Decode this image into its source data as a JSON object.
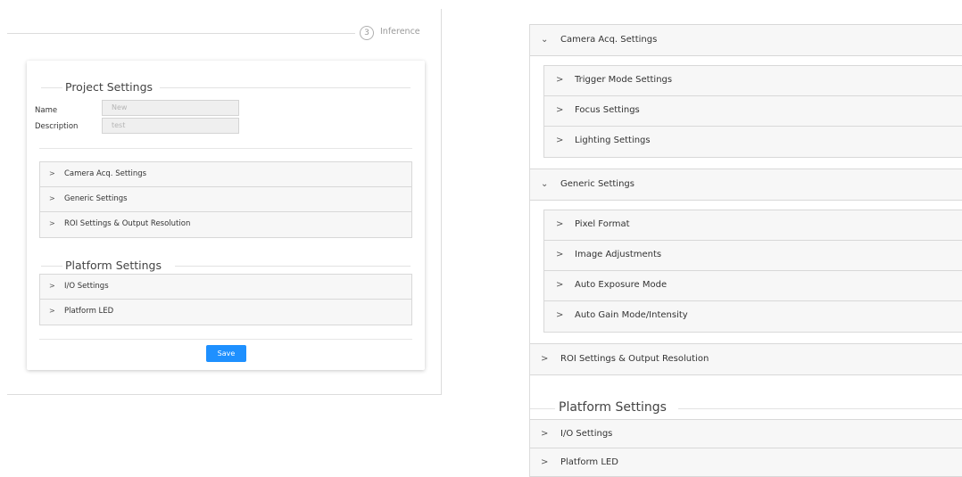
{
  "left": {
    "stepper": {
      "step_number": "3",
      "step_label": "Inference"
    },
    "project_settings": {
      "heading": "Project Settings",
      "name_label": "Name",
      "name_value": "New",
      "description_label": "Description",
      "description_value": "test"
    },
    "camera_group": [
      {
        "label": "Camera Acq. Settings"
      },
      {
        "label": "Generic Settings"
      },
      {
        "label": "ROI Settings & Output Resolution"
      }
    ],
    "platform_settings": {
      "heading": "Platform Settings",
      "items": [
        {
          "label": "I/O Settings"
        },
        {
          "label": "Platform LED"
        }
      ]
    },
    "save_label": "Save",
    "colors": {
      "save_button": "#1e90ff",
      "row_background": "#f7f7f7",
      "border": "#d8d8d8"
    }
  },
  "right": {
    "camera_acq": {
      "label": "Camera Acq. Settings",
      "children": [
        {
          "label": "Trigger Mode Settings"
        },
        {
          "label": "Focus Settings"
        },
        {
          "label": "Lighting Settings"
        }
      ]
    },
    "generic": {
      "label": "Generic Settings",
      "children": [
        {
          "label": "Pixel Format"
        },
        {
          "label": "Image Adjustments"
        },
        {
          "label": "Auto Exposure Mode"
        },
        {
          "label": "Auto Gain Mode/Intensity"
        }
      ]
    },
    "roi": {
      "label": "ROI Settings & Output Resolution"
    },
    "platform_settings": {
      "heading": "Platform Settings",
      "items": [
        {
          "label": "I/O Settings"
        },
        {
          "label": "Platform LED"
        }
      ]
    }
  },
  "icons": {
    "collapsed": "chevron-right-icon",
    "expanded": "chevron-down-icon"
  }
}
